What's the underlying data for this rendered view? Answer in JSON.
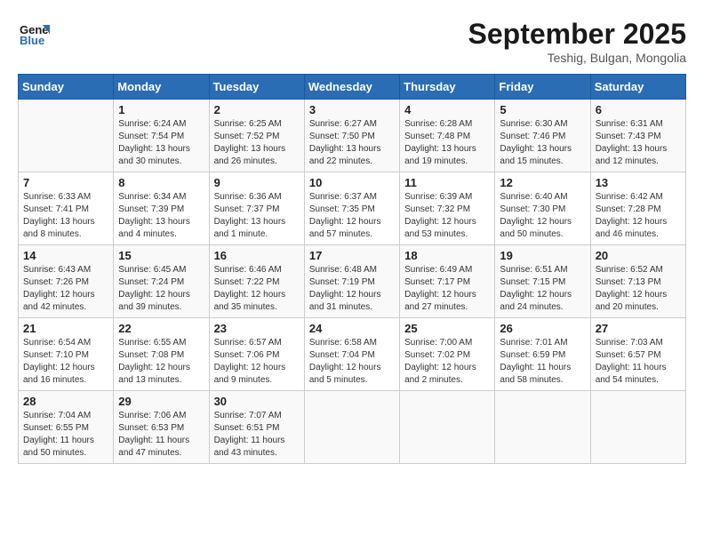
{
  "header": {
    "logo_line1": "General",
    "logo_line2": "Blue",
    "title": "September 2025",
    "subtitle": "Teshig, Bulgan, Mongolia"
  },
  "calendar": {
    "weekdays": [
      "Sunday",
      "Monday",
      "Tuesday",
      "Wednesday",
      "Thursday",
      "Friday",
      "Saturday"
    ],
    "weeks": [
      [
        {
          "day": "",
          "info": ""
        },
        {
          "day": "1",
          "info": "Sunrise: 6:24 AM\nSunset: 7:54 PM\nDaylight: 13 hours\nand 30 minutes."
        },
        {
          "day": "2",
          "info": "Sunrise: 6:25 AM\nSunset: 7:52 PM\nDaylight: 13 hours\nand 26 minutes."
        },
        {
          "day": "3",
          "info": "Sunrise: 6:27 AM\nSunset: 7:50 PM\nDaylight: 13 hours\nand 22 minutes."
        },
        {
          "day": "4",
          "info": "Sunrise: 6:28 AM\nSunset: 7:48 PM\nDaylight: 13 hours\nand 19 minutes."
        },
        {
          "day": "5",
          "info": "Sunrise: 6:30 AM\nSunset: 7:46 PM\nDaylight: 13 hours\nand 15 minutes."
        },
        {
          "day": "6",
          "info": "Sunrise: 6:31 AM\nSunset: 7:43 PM\nDaylight: 13 hours\nand 12 minutes."
        }
      ],
      [
        {
          "day": "7",
          "info": "Sunrise: 6:33 AM\nSunset: 7:41 PM\nDaylight: 13 hours\nand 8 minutes."
        },
        {
          "day": "8",
          "info": "Sunrise: 6:34 AM\nSunset: 7:39 PM\nDaylight: 13 hours\nand 4 minutes."
        },
        {
          "day": "9",
          "info": "Sunrise: 6:36 AM\nSunset: 7:37 PM\nDaylight: 13 hours\nand 1 minute."
        },
        {
          "day": "10",
          "info": "Sunrise: 6:37 AM\nSunset: 7:35 PM\nDaylight: 12 hours\nand 57 minutes."
        },
        {
          "day": "11",
          "info": "Sunrise: 6:39 AM\nSunset: 7:32 PM\nDaylight: 12 hours\nand 53 minutes."
        },
        {
          "day": "12",
          "info": "Sunrise: 6:40 AM\nSunset: 7:30 PM\nDaylight: 12 hours\nand 50 minutes."
        },
        {
          "day": "13",
          "info": "Sunrise: 6:42 AM\nSunset: 7:28 PM\nDaylight: 12 hours\nand 46 minutes."
        }
      ],
      [
        {
          "day": "14",
          "info": "Sunrise: 6:43 AM\nSunset: 7:26 PM\nDaylight: 12 hours\nand 42 minutes."
        },
        {
          "day": "15",
          "info": "Sunrise: 6:45 AM\nSunset: 7:24 PM\nDaylight: 12 hours\nand 39 minutes."
        },
        {
          "day": "16",
          "info": "Sunrise: 6:46 AM\nSunset: 7:22 PM\nDaylight: 12 hours\nand 35 minutes."
        },
        {
          "day": "17",
          "info": "Sunrise: 6:48 AM\nSunset: 7:19 PM\nDaylight: 12 hours\nand 31 minutes."
        },
        {
          "day": "18",
          "info": "Sunrise: 6:49 AM\nSunset: 7:17 PM\nDaylight: 12 hours\nand 27 minutes."
        },
        {
          "day": "19",
          "info": "Sunrise: 6:51 AM\nSunset: 7:15 PM\nDaylight: 12 hours\nand 24 minutes."
        },
        {
          "day": "20",
          "info": "Sunrise: 6:52 AM\nSunset: 7:13 PM\nDaylight: 12 hours\nand 20 minutes."
        }
      ],
      [
        {
          "day": "21",
          "info": "Sunrise: 6:54 AM\nSunset: 7:10 PM\nDaylight: 12 hours\nand 16 minutes."
        },
        {
          "day": "22",
          "info": "Sunrise: 6:55 AM\nSunset: 7:08 PM\nDaylight: 12 hours\nand 13 minutes."
        },
        {
          "day": "23",
          "info": "Sunrise: 6:57 AM\nSunset: 7:06 PM\nDaylight: 12 hours\nand 9 minutes."
        },
        {
          "day": "24",
          "info": "Sunrise: 6:58 AM\nSunset: 7:04 PM\nDaylight: 12 hours\nand 5 minutes."
        },
        {
          "day": "25",
          "info": "Sunrise: 7:00 AM\nSunset: 7:02 PM\nDaylight: 12 hours\nand 2 minutes."
        },
        {
          "day": "26",
          "info": "Sunrise: 7:01 AM\nSunset: 6:59 PM\nDaylight: 11 hours\nand 58 minutes."
        },
        {
          "day": "27",
          "info": "Sunrise: 7:03 AM\nSunset: 6:57 PM\nDaylight: 11 hours\nand 54 minutes."
        }
      ],
      [
        {
          "day": "28",
          "info": "Sunrise: 7:04 AM\nSunset: 6:55 PM\nDaylight: 11 hours\nand 50 minutes."
        },
        {
          "day": "29",
          "info": "Sunrise: 7:06 AM\nSunset: 6:53 PM\nDaylight: 11 hours\nand 47 minutes."
        },
        {
          "day": "30",
          "info": "Sunrise: 7:07 AM\nSunset: 6:51 PM\nDaylight: 11 hours\nand 43 minutes."
        },
        {
          "day": "",
          "info": ""
        },
        {
          "day": "",
          "info": ""
        },
        {
          "day": "",
          "info": ""
        },
        {
          "day": "",
          "info": ""
        }
      ]
    ]
  }
}
